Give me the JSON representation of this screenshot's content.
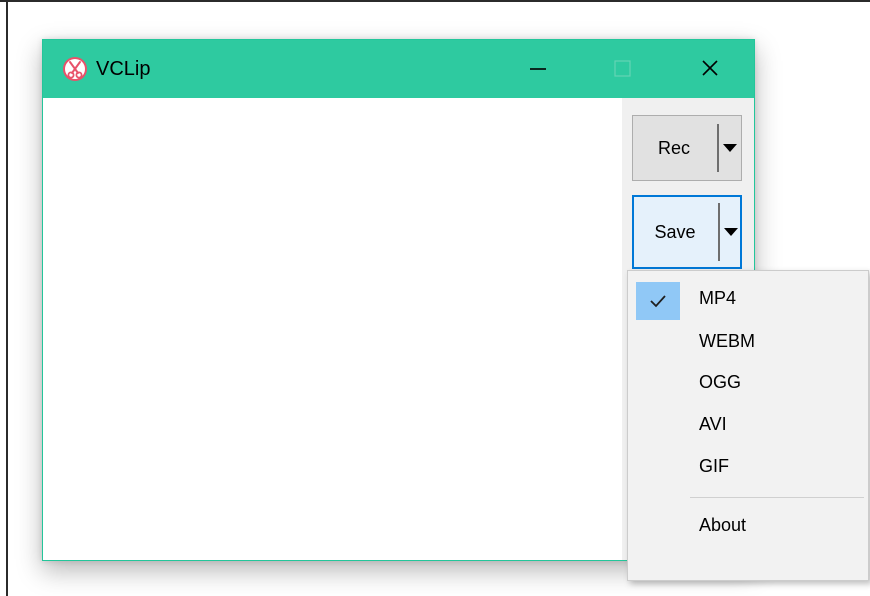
{
  "window": {
    "title": "VCLip",
    "icon": "scissors-icon",
    "controls": {
      "minimize": "minimize-icon",
      "maximize": "maximize-icon",
      "close": "close-icon"
    }
  },
  "toolbar": {
    "rec_label": "Rec",
    "save_label": "Save",
    "dropdown_icon": "dropdown-arrow-icon"
  },
  "menu": {
    "formats": [
      {
        "label": "MP4",
        "checked": true
      },
      {
        "label": "WEBM",
        "checked": false
      },
      {
        "label": "OGG",
        "checked": false
      },
      {
        "label": "AVI",
        "checked": false
      },
      {
        "label": "GIF",
        "checked": false
      }
    ],
    "about_label": "About"
  },
  "colors": {
    "titlebar": "#2ecaa0",
    "focus_border": "#0078d7",
    "check_highlight": "#90c8f6"
  }
}
